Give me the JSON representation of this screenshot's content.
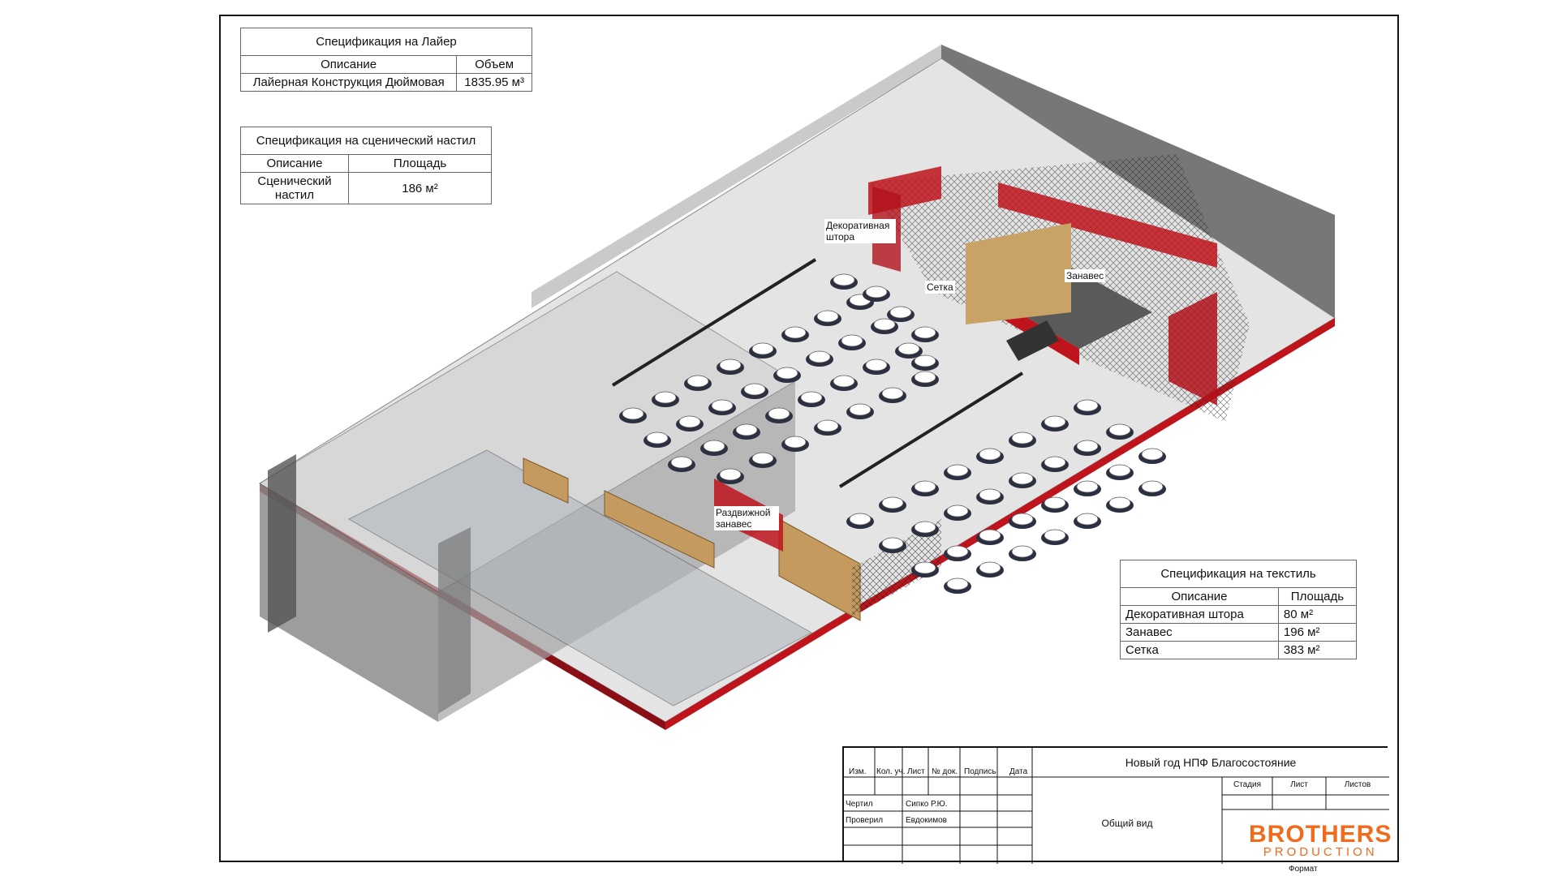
{
  "spec_layer": {
    "title": "Спецификация на Лайер",
    "col_desc": "Описание",
    "col_val": "Объем",
    "row_desc": "Лайерная Конструкция Дюймовая",
    "row_val": "1835.95 м³"
  },
  "spec_stage": {
    "title": "Спецификация на сценический настил",
    "col_desc": "Описание",
    "col_val": "Площадь",
    "row_desc": "Сценический настил",
    "row_val": "186 м²"
  },
  "spec_textile": {
    "title": "Спецификация на текстиль",
    "col_desc": "Описание",
    "col_val": "Площадь",
    "rows": [
      {
        "desc": "Декоративная штора",
        "val": "80 м²"
      },
      {
        "desc": "Занавес",
        "val": "196 м²"
      },
      {
        "desc": "Сетка",
        "val": "383 м²"
      }
    ]
  },
  "callouts": {
    "decor_curtain": "Декоративная штора",
    "net": "Сетка",
    "curtain": "Занавес",
    "sliding_curtain": "Раздвижной занавес"
  },
  "title_block": {
    "project": "Новый год НПФ Благосостояние",
    "sheet_name": "Общий вид",
    "col_izm": "Изм.",
    "col_kol": "Кол. уч.",
    "col_list": "Лист",
    "col_ndok": "№ док.",
    "col_sign": "Подпись",
    "col_date": "Дата",
    "drawn_label": "Чертил",
    "drawn_name": "Сипко Р.Ю.",
    "checked_label": "Проверил",
    "checked_name": "Евдокимов",
    "stage_label": "Стадия",
    "sheet_label": "Лист",
    "sheets_label": "Листов",
    "format_label": "Формат",
    "logo_top": "BROTHERS",
    "logo_bottom": "PRODUCTION"
  },
  "colors": {
    "floor": "#e4e4e4",
    "wall": "#6b6b6b",
    "accent_red": "#c0141c",
    "wood": "#c49a5e",
    "logo_orange": "#f26a1b"
  }
}
